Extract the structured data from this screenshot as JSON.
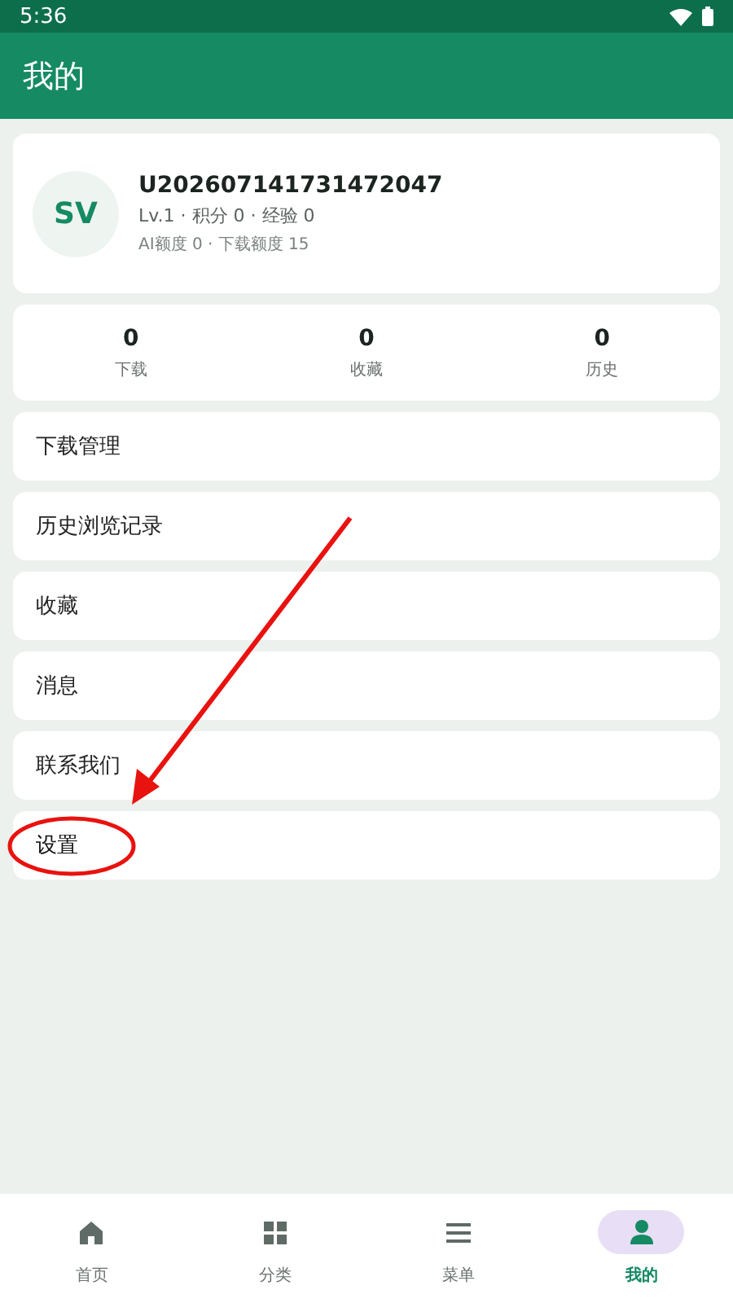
{
  "status_bar": {
    "time": "5:36"
  },
  "header": {
    "title": "我的"
  },
  "profile": {
    "avatar": "SV",
    "username": "U202607141731472047",
    "stats_line": "Lv.1 · 积分 0 · 经验 0",
    "quota_line": "AI额度 0 · 下载额度 15"
  },
  "counters": [
    {
      "value": "0",
      "label": "下载"
    },
    {
      "value": "0",
      "label": "收藏"
    },
    {
      "value": "0",
      "label": "历史"
    }
  ],
  "menu": [
    {
      "label": "下载管理",
      "highlighted": false
    },
    {
      "label": "历史浏览记录",
      "highlighted": false
    },
    {
      "label": "收藏",
      "highlighted": false
    },
    {
      "label": "消息",
      "highlighted": false
    },
    {
      "label": "联系我们",
      "highlighted": false
    },
    {
      "label": "设置",
      "highlighted": true
    }
  ],
  "bottom_nav": [
    {
      "label": "首页",
      "kind": "home",
      "selected": false
    },
    {
      "label": "分类",
      "kind": "grid",
      "selected": false
    },
    {
      "label": "菜单",
      "kind": "menu",
      "selected": false
    },
    {
      "label": "我的",
      "kind": "person",
      "selected": true
    }
  ]
}
